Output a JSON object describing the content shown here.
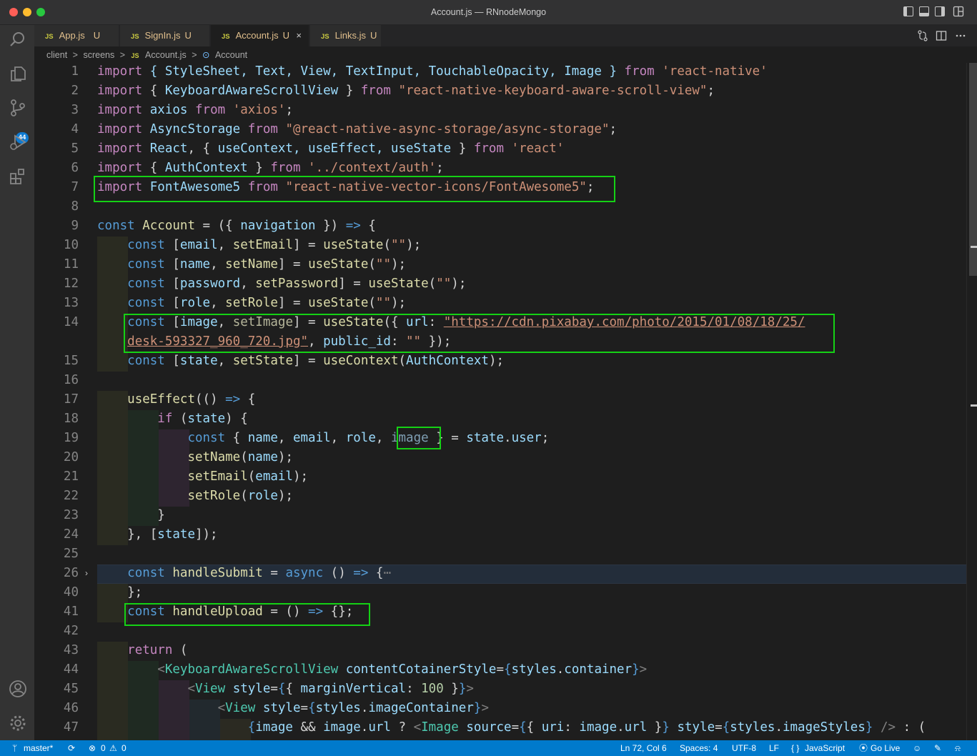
{
  "window": {
    "title": "Account.js — RNnodeMongo"
  },
  "activity_bar": {
    "scm_badge": "44"
  },
  "tabs": [
    {
      "label": "App.js",
      "status": "U",
      "icon": "JS"
    },
    {
      "label": "SignIn.js",
      "status": "U",
      "icon": "JS"
    },
    {
      "label": "Account.js",
      "status": "U",
      "icon": "JS",
      "active": true,
      "close": "×"
    },
    {
      "label": "Links.js",
      "status": "U",
      "icon": "JS"
    }
  ],
  "breadcrumb": {
    "parts": [
      "client",
      "screens",
      "Account.js",
      "Account"
    ],
    "sep": ">",
    "file_icon": "JS",
    "symbol_icon": "⊙"
  },
  "editor": {
    "line_numbers": [
      "1",
      "2",
      "3",
      "4",
      "5",
      "6",
      "7",
      "8",
      "9",
      "10",
      "11",
      "12",
      "13",
      "14",
      "",
      "15",
      "16",
      "17",
      "18",
      "19",
      "20",
      "21",
      "22",
      "23",
      "24",
      "25",
      "26",
      "40",
      "41",
      "42",
      "43",
      "44",
      "45",
      "46",
      "47"
    ],
    "folded_marker": "⋯",
    "tokens": {
      "import": "import",
      "from": "from",
      "const": "const",
      "if": "if",
      "return": "return",
      "async": "async",
      "arrow": "=>",
      "l1_names": "{ StyleSheet, Text, View, TextInput, TouchableOpacity, Image }",
      "l1_src": "'react-native'",
      "l2_name": "KeyboardAwareScrollView",
      "l2_src": "\"react-native-keyboard-aware-scroll-view\"",
      "l3_name": "axios",
      "l3_src": "'axios'",
      "l4_name": "AsyncStorage",
      "l4_src": "\"@react-native-async-storage/async-storage\"",
      "l5_react": "React",
      "l5_hooks": "useContext, useEffect, useState",
      "l5_src": "'react'",
      "l6_name": "AuthContext",
      "l6_src": "'../context/auth'",
      "l7_name": "FontAwesome5",
      "l7_src": "\"react-native-vector-icons/FontAwesome5\"",
      "l9_name": "Account",
      "l9_param": "navigation",
      "useState": "useState",
      "useContext": "useContext",
      "useEffect": "useEffect",
      "email": "email",
      "setEmail": "setEmail",
      "name": "name",
      "setName": "setName",
      "password": "password",
      "setPassword": "setPassword",
      "role": "role",
      "setRole": "setRole",
      "image": "image",
      "setImage": "setImage",
      "url_key": "url",
      "url_a": "\"https://cdn.pixabay.com/photo/2015/01/08/18/25/",
      "url_b": "desk-593327_960_720.jpg\"",
      "public_id": "public_id",
      "empty_str": "\"\"",
      "state": "state",
      "setState": "setState",
      "AuthContext": "AuthContext",
      "user": "user",
      "handleSubmit": "handleSubmit",
      "handleUpload": "handleUpload",
      "KASV": "KeyboardAwareScrollView",
      "contentStyle": "contentCotainerStyle",
      "styles": "styles",
      "container": "container",
      "View": "View",
      "style": "style",
      "marginVertical": "marginVertical",
      "num100": "100",
      "imageContainer": "imageContainer",
      "Image": "Image",
      "source": "source",
      "uri": "uri",
      "imageStyles": "imageStyles"
    }
  },
  "status_bar": {
    "branch": "master*",
    "errors": "0",
    "warnings": "0",
    "position": "Ln 72, Col 6",
    "spaces": "Spaces: 4",
    "encoding": "UTF-8",
    "eol": "LF",
    "language": "JavaScript",
    "go_live": "Go Live"
  }
}
